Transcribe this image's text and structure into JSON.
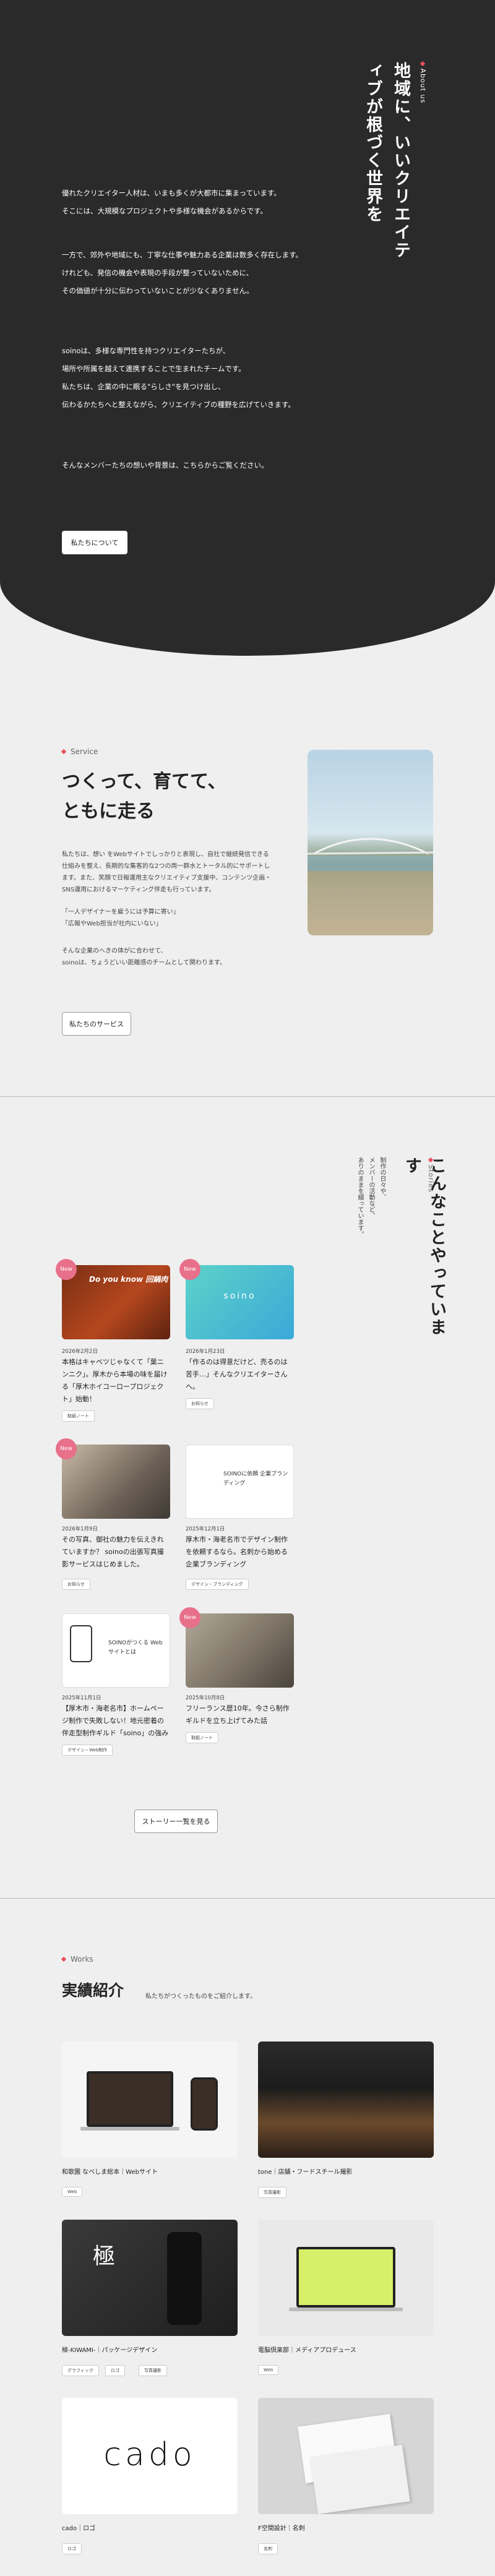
{
  "about": {
    "label": "About us",
    "title": "地域に、いいクリエイティブが根づく世界を",
    "paragraphs": [
      [
        "優れたクリエイター人材は、いまも多くが大都市に集まっています。",
        "そこには、大規模なプロジェクトや多様な機会があるからです。"
      ],
      [
        "一方で、郊外や地域にも、丁寧な仕事や魅力ある企業は数多く存在します。",
        "けれども、発信の機会や表現の手段が整っていないために、",
        "その価値が十分に伝わっていないことが少なくありません。"
      ],
      [
        "soinoは、多様な専門性を持つクリエイターたちが、",
        "場所や所属を越えて連携することで生まれたチームです。",
        "私たちは、企業の中に眠る\"らしさ\"を見つけ出し、",
        "伝わるかたちへと整えながら、クリエイティブの種野を広げていきます。"
      ],
      [
        "そんなメンバーたちの想いや背景は、こちらからご覧ください。"
      ]
    ],
    "button": "私たちについて"
  },
  "service": {
    "label": "Service",
    "title_lines": [
      "つくって、育てて、",
      "ともに走る"
    ],
    "paragraph1": [
      "私たちは、想い をWebサイトでしっかりと表現し、自社で継続発信できる",
      "仕組みを整え、長期的な集客的な2つの両一群水とトータル的にサポートし",
      "ます。また、笑顔で日報運用主なクリエイティブ支援中、コンテンツ企画・",
      "SNS運用におけるマーケティング伴走も行っています。"
    ],
    "quotes": [
      "「一人デザイナーを雇うには予算に寄い」",
      "「広報やWeb担当が社内にいない」"
    ],
    "paragraph2": [
      "そんな企業のへきの体がに合わせて、",
      "soinoは、ちょうどいい距離感のチームとして関わります。"
    ],
    "button": "私たちのサービス"
  },
  "stories": {
    "label": "Stories",
    "title_lines": [
      "こんなことやっています"
    ],
    "subtitle_lines": [
      "制作の日々や、",
      "メンバーの活動など、",
      "ありのままを綴っています。"
    ],
    "new_badge": "New",
    "cards": [
      {
        "image_text": "Do you know 回鍋肉",
        "date": "2026年2月2日",
        "title": "本格はキャベツじゃなくて「葉ニンニク」。厚木から本場の味を届ける「厚木ホイコーロープロジェクト」始動！",
        "tags": [
          "取組ノート"
        ],
        "new": true
      },
      {
        "image_text": "soino",
        "date": "2026年1月23日",
        "title": "「作るのは得意だけど、売るのは苦手…」そんなクリエイターさんへ。",
        "tags": [
          "お知らせ"
        ],
        "new": true
      },
      {
        "image_text": "",
        "date": "2026年1月9日",
        "title": "その写真、御社の魅力を伝えきれていますか？ soinoの出張写真撮影サービスはじめました。",
        "tags": [
          "お知らせ"
        ],
        "new": true
      },
      {
        "image_text": "SOINOに依頼 企業ブランディング",
        "date": "2025年12月1日",
        "title": "厚木市・海老名市でデザイン制作を依頼するなら。名刺から始める企業ブランディング",
        "tags": [
          "デザイン・ブランディング"
        ],
        "new": false
      },
      {
        "image_text": "SOINOがつくる Webサイトとは",
        "date": "2025年11月1日",
        "title": "【厚木市・海老名市】ホームページ制作で失敗しない！地元密着の伴走型制作ギルド「soino」の強み",
        "tags": [
          "デザイン・Web制作"
        ],
        "new": false
      },
      {
        "image_text": "",
        "date": "2025年10月8日",
        "title": "フリーランス歴10年。今さら制作ギルドを立ち上げてみた話",
        "tags": [
          "取組ノート"
        ],
        "new": true
      }
    ],
    "button": "ストーリー一覧を見る"
  },
  "works": {
    "label": "Works",
    "title": "実績紹介",
    "subtitle": "私たちがつくったものをご紹介します。",
    "items": [
      {
        "caption": "和歌園 なべしま総本｜Webサイト",
        "tags": [
          "Web"
        ]
      },
      {
        "caption": "tone｜店舗・フードスチール撮影",
        "tags": [
          "写真撮影"
        ]
      },
      {
        "caption": "極-KIWAMI-｜パッケージデザイン",
        "tags": [
          "グラフィック",
          "ロゴ",
          "写真撮影"
        ]
      },
      {
        "caption": "電脳倶楽部｜メディアプロデュース",
        "tags": [
          "Web"
        ]
      },
      {
        "caption": "cado｜ロゴ",
        "tags": [
          "ロゴ"
        ]
      },
      {
        "caption": "F空間設計｜名刺",
        "tags": [
          "名刺"
        ]
      }
    ],
    "logos": {
      "kiwami": "極",
      "cado": "cado"
    }
  }
}
